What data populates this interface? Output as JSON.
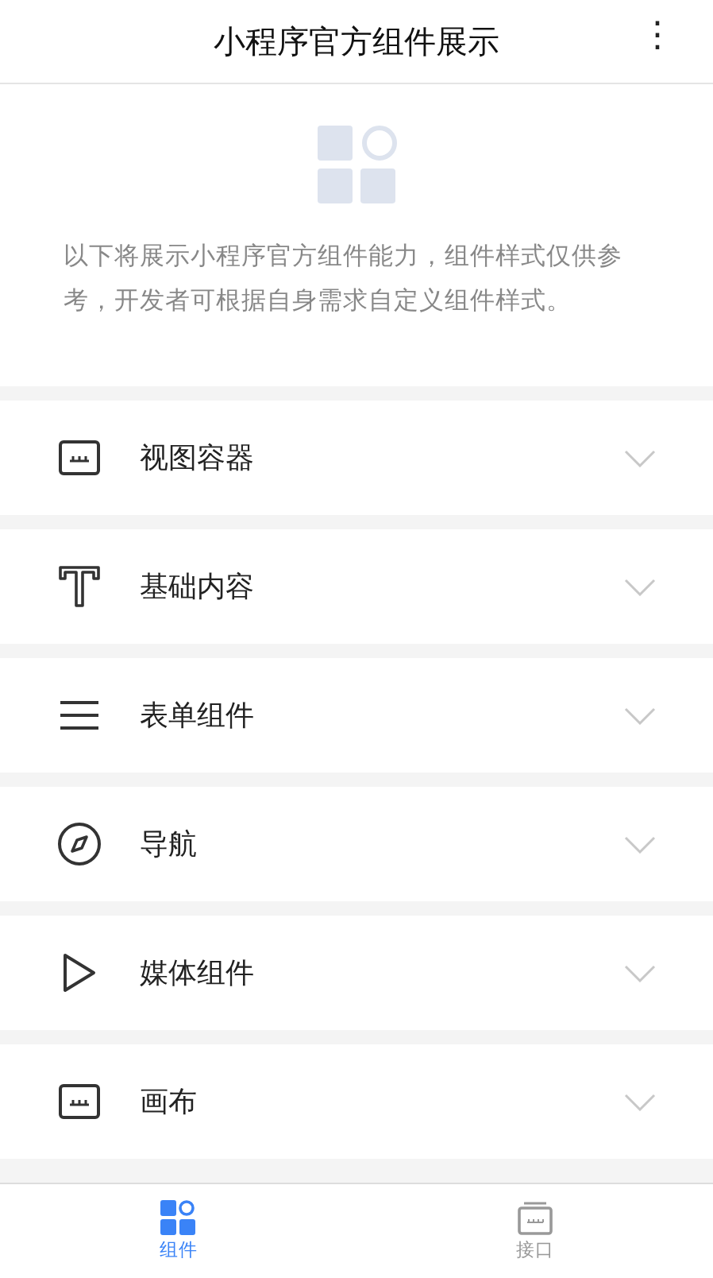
{
  "header": {
    "title": "小程序官方组件展示",
    "menu": "⋮"
  },
  "intro": {
    "text": "以下将展示小程序官方组件能力，组件样式仅供参考，开发者可根据自身需求自定义组件样式。"
  },
  "categories": [
    {
      "kind": "view",
      "label": "视图容器",
      "expanded": false
    },
    {
      "kind": "text",
      "label": "基础内容",
      "expanded": false
    },
    {
      "kind": "form",
      "label": "表单组件",
      "expanded": false
    },
    {
      "kind": "nav",
      "label": "导航",
      "expanded": false
    },
    {
      "kind": "media",
      "label": "媒体组件",
      "expanded": false
    },
    {
      "kind": "canvas",
      "label": "画布",
      "expanded": false
    }
  ],
  "tabs": [
    {
      "kind": "components",
      "label": "组件",
      "selected": true
    },
    {
      "kind": "api",
      "label": "接口",
      "selected": false
    }
  ]
}
